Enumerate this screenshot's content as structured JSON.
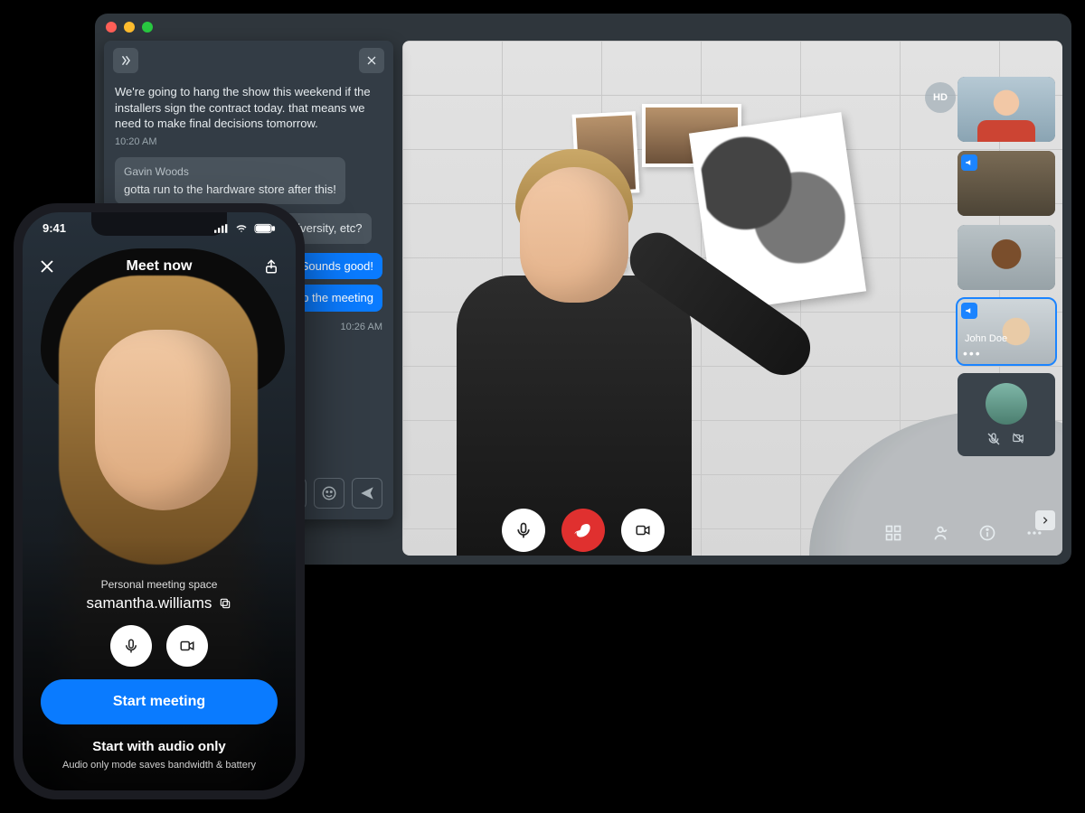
{
  "desktop": {
    "traffic_colors": [
      "#ff5f57",
      "#febc2e",
      "#28c840"
    ],
    "hd_badge": "HD",
    "chat": {
      "messages": [
        {
          "sender": "",
          "text": "We're going to hang the show this weekend if the installers sign the contract today. that means we need to make final decisions tomorrow.",
          "time": "10:20 AM",
          "style": "plain"
        },
        {
          "sender": "Gavin Woods",
          "text": "gotta run to the hardware store after this!",
          "time": "",
          "style": "bubble"
        },
        {
          "sender": "",
          "text": "…ould you and …o make sure …iversity, etc?",
          "time": "",
          "style": "bubble"
        }
      ],
      "outgoing": [
        {
          "text": "Sounds good!"
        },
        {
          "text": "up the meeting"
        }
      ],
      "outgoing_time": "10:26 AM"
    },
    "participants": [
      {
        "id": "p1",
        "badge": null,
        "label": ""
      },
      {
        "id": "p2",
        "badge": "megaphone",
        "label": ""
      },
      {
        "id": "p3",
        "badge": null,
        "label": ""
      },
      {
        "id": "p4",
        "badge": "megaphone",
        "label": "John Doe",
        "selected": true
      },
      {
        "id": "p5",
        "badge": null,
        "label": "",
        "muted": true,
        "novideo": true
      }
    ]
  },
  "phone": {
    "status_time": "9:41",
    "title": "Meet now",
    "pms_label": "Personal meeting space",
    "pms_name": "samantha.williams",
    "primary": "Start meeting",
    "secondary": "Start with audio only",
    "hint": "Audio only mode saves bandwidth & battery"
  },
  "ellipsis": "•••"
}
